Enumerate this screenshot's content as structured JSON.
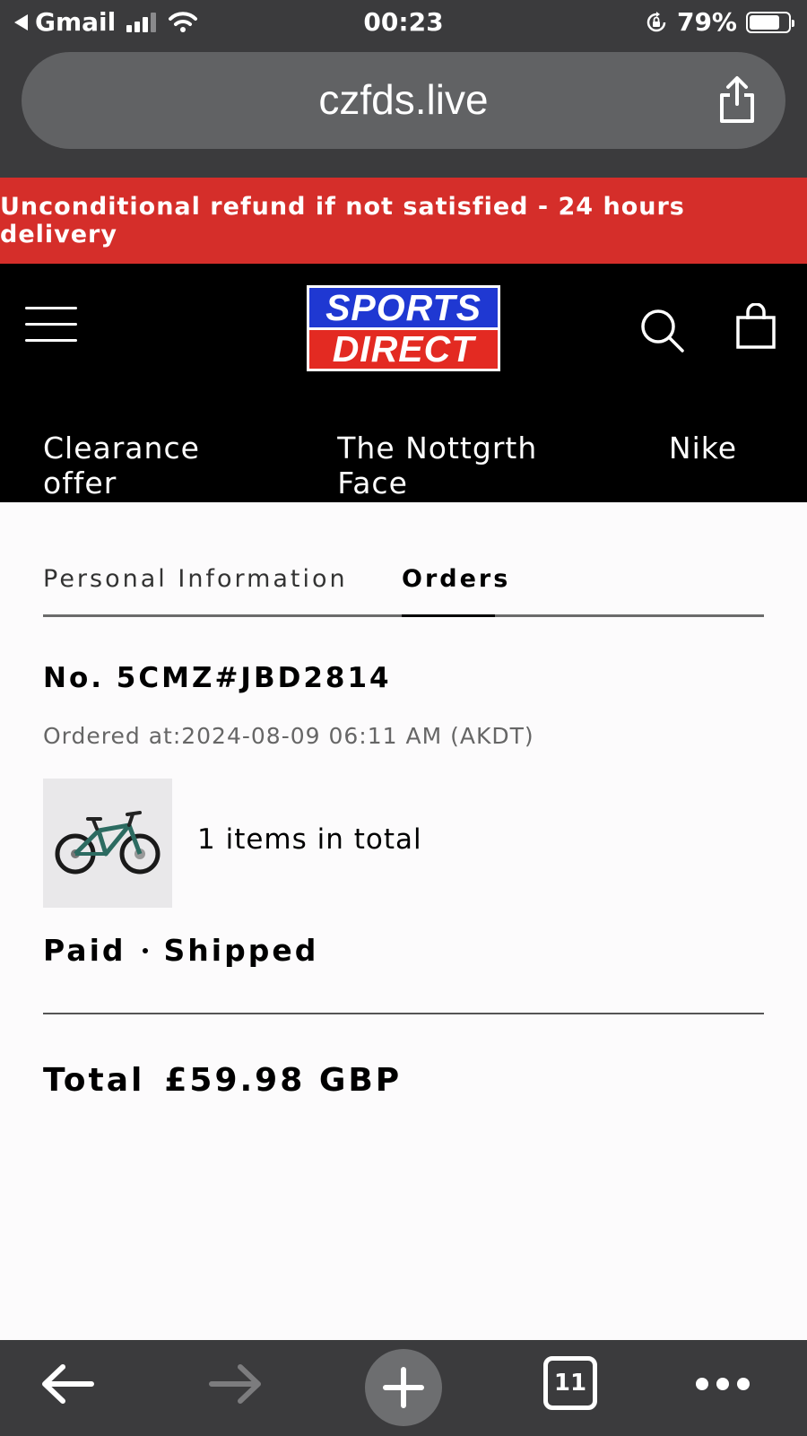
{
  "status_bar": {
    "back_app": "Gmail",
    "time": "00:23",
    "battery": "79%",
    "battery_level": 0.79
  },
  "browser": {
    "url": "czfds.live",
    "tabs_count": "11"
  },
  "promo": {
    "text": "Unconditional refund if not satisfied - 24 hours delivery"
  },
  "site": {
    "logo_top": "SPORTS",
    "logo_bottom": "DIRECT",
    "nav": [
      "Clearance offer",
      "The Nottgrth Face",
      "Nike"
    ]
  },
  "account_tabs": {
    "personal": "Personal Information",
    "orders": "Orders",
    "active": "orders"
  },
  "order": {
    "number": "No. 5CMZ#JBD2814",
    "ordered_at": "Ordered at:2024-08-09 06:11 AM (AKDT)",
    "items_total": "1 items in total",
    "payment_status": "Paid",
    "shipping_status": "Shipped",
    "total_label": "Total",
    "total_amount": "£59.98 GBP"
  },
  "colors": {
    "promo_red": "#d52e2a",
    "logo_blue": "#1f38d2",
    "logo_red": "#e32a22",
    "chrome_dark": "#3b3b3d"
  }
}
